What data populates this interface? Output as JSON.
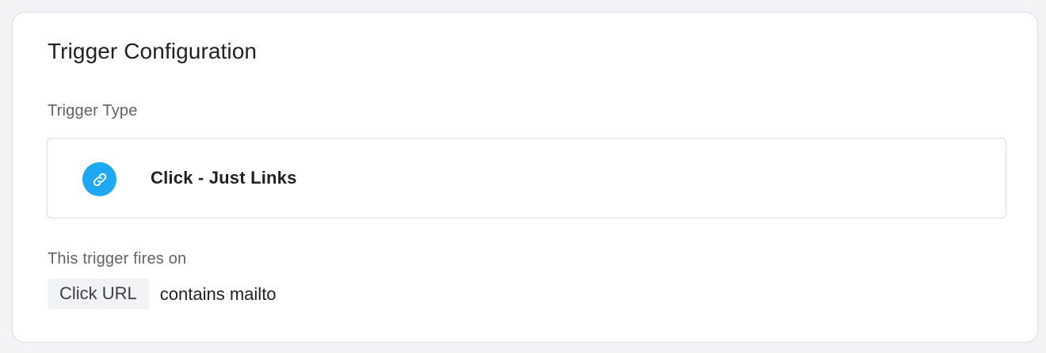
{
  "card": {
    "title": "Trigger Configuration",
    "trigger_type_label": "Trigger Type",
    "trigger_type": {
      "icon": "link-icon",
      "icon_color": "#1ea7f2",
      "name": "Click - Just Links"
    },
    "fires_on_label": "This trigger fires on",
    "condition": {
      "variable": "Click URL",
      "text": "contains mailto"
    }
  }
}
